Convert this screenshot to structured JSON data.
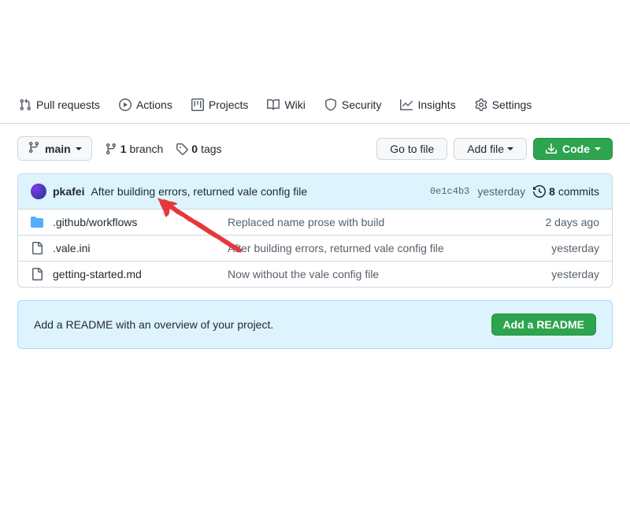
{
  "nav": {
    "items": [
      {
        "label": "Pull requests",
        "icon": "git-pull-request-icon"
      },
      {
        "label": "Actions",
        "icon": "play-icon"
      },
      {
        "label": "Projects",
        "icon": "project-icon"
      },
      {
        "label": "Wiki",
        "icon": "book-icon"
      },
      {
        "label": "Security",
        "icon": "shield-icon"
      },
      {
        "label": "Insights",
        "icon": "graph-icon"
      },
      {
        "label": "Settings",
        "icon": "gear-icon"
      }
    ]
  },
  "toolbar": {
    "branch_name": "main",
    "branch_count": "1",
    "branch_label": "branch",
    "tag_count": "0",
    "tag_label": "tags",
    "go_to_file": "Go to file",
    "add_file": "Add file",
    "code": "Code"
  },
  "commit": {
    "author": "pkafei",
    "message": "After building errors, returned vale config file",
    "sha": "0e1c4b3",
    "when": "yesterday",
    "commits_count": "8",
    "commits_label": "commits"
  },
  "files": [
    {
      "type": "dir",
      "name": ".github/workflows",
      "msg": "Replaced name prose with build",
      "time": "2 days ago"
    },
    {
      "type": "file",
      "name": ".vale.ini",
      "msg": "After building errors, returned vale config file",
      "time": "yesterday"
    },
    {
      "type": "file",
      "name": "getting-started.md",
      "msg": "Now without the vale config file",
      "time": "yesterday"
    }
  ],
  "readme": {
    "prompt": "Add a README with an overview of your project.",
    "button": "Add a README"
  }
}
